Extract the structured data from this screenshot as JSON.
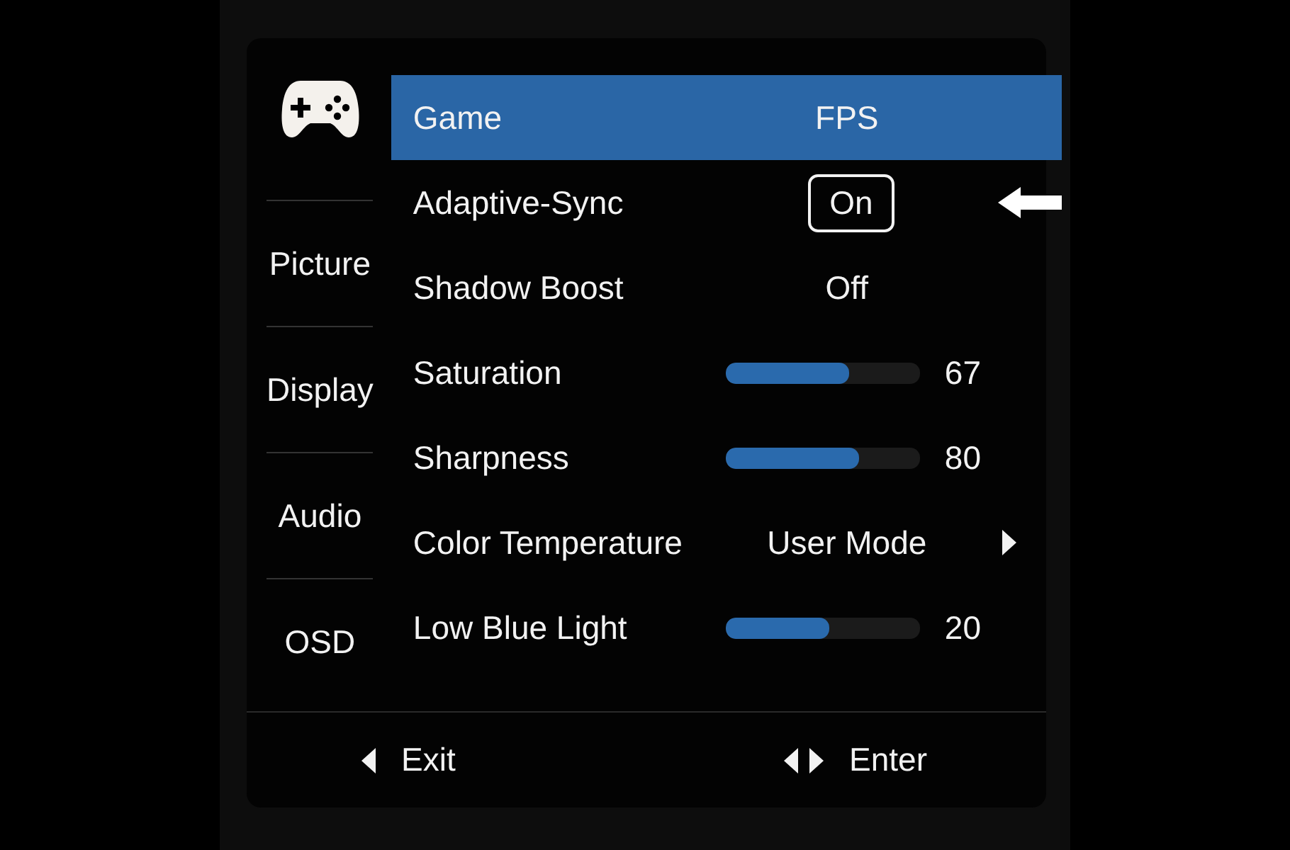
{
  "sidebar": {
    "items": [
      {
        "label": "Picture"
      },
      {
        "label": "Display"
      },
      {
        "label": "Audio"
      },
      {
        "label": "OSD"
      }
    ]
  },
  "rows": [
    {
      "kind": "value",
      "label": "Game",
      "value": "FPS",
      "selected": true
    },
    {
      "kind": "boxed",
      "label": "Adaptive-Sync",
      "value": "On",
      "selected": false
    },
    {
      "kind": "value",
      "label": "Shadow Boost",
      "value": "Off",
      "selected": false
    },
    {
      "kind": "slider",
      "label": "Saturation",
      "level": 0.63,
      "reading": "67",
      "selected": false
    },
    {
      "kind": "slider",
      "label": "Sharpness",
      "level": 0.68,
      "reading": "80",
      "selected": false
    },
    {
      "kind": "submenu",
      "label": "Color Temperature",
      "value": "User Mode",
      "selected": false
    },
    {
      "kind": "slider",
      "label": "Low Blue Light",
      "level": 0.53,
      "reading": "20",
      "selected": false
    }
  ],
  "footer": [
    {
      "kind": "back",
      "label": "Exit"
    },
    {
      "kind": "leftright",
      "label": "Enter"
    }
  ]
}
